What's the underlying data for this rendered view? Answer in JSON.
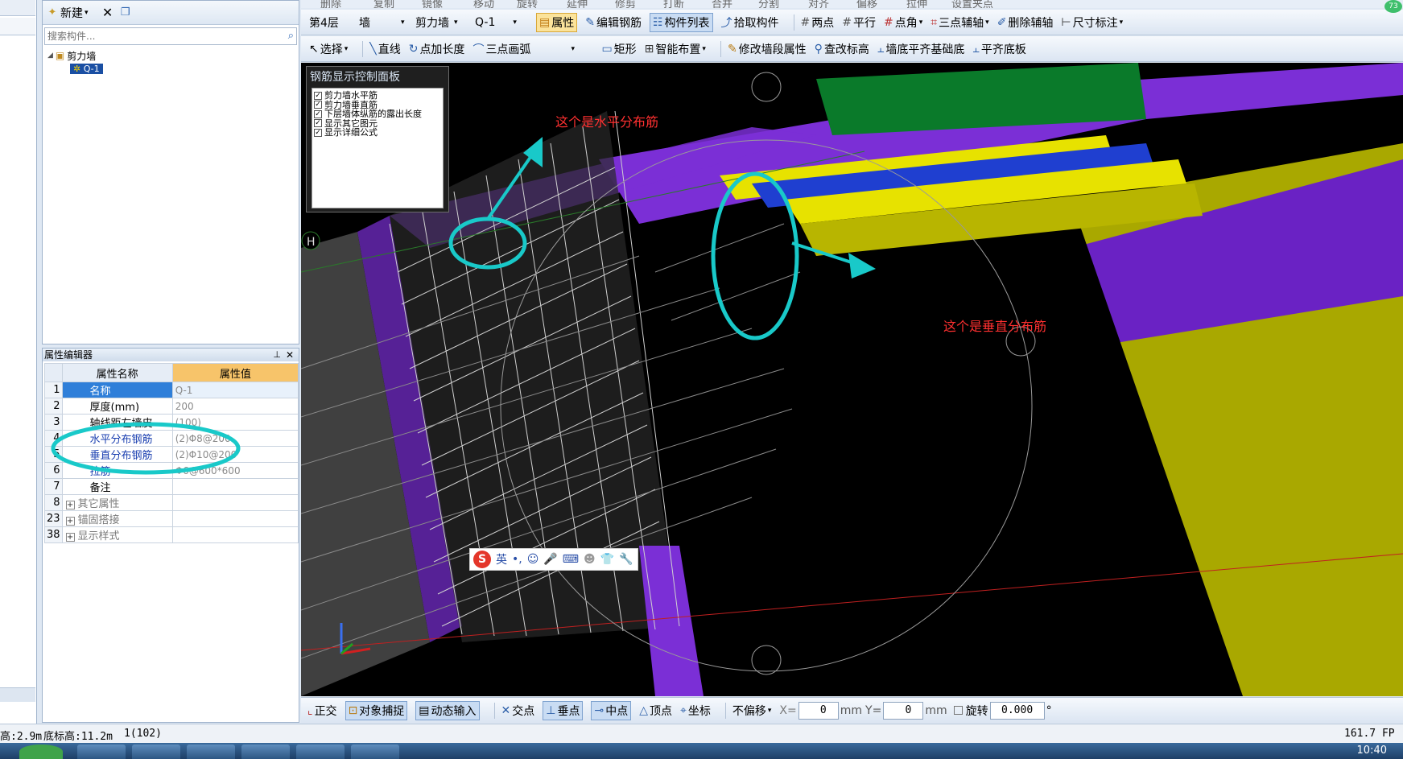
{
  "component_panel": {
    "new_label": "新建",
    "search_placeholder": "搜索构件...",
    "tree": {
      "root": "剪力墙",
      "child": "Q-1"
    }
  },
  "property_editor": {
    "title": "属性编辑器",
    "header_name": "属性名称",
    "header_value": "属性值",
    "rows": [
      {
        "num": "1",
        "name": "名称",
        "value": "Q-1"
      },
      {
        "num": "2",
        "name": "厚度(mm)",
        "value": "200"
      },
      {
        "num": "3",
        "name": "轴线距左墙皮",
        "value": "(100)"
      },
      {
        "num": "4",
        "name": "水平分布钢筋",
        "value": "(2)Φ8@200"
      },
      {
        "num": "5",
        "name": "垂直分布钢筋",
        "value": "(2)Φ10@200"
      },
      {
        "num": "6",
        "name": "拉筋",
        "value": "Φ6@600*600"
      },
      {
        "num": "7",
        "name": "备注",
        "value": ""
      },
      {
        "num": "8",
        "name": "其它属性",
        "value": ""
      },
      {
        "num": "23",
        "name": "锚固搭接",
        "value": ""
      },
      {
        "num": "38",
        "name": "显示样式",
        "value": ""
      }
    ]
  },
  "toolbar_top": [
    "删除",
    "复制",
    "镜像",
    "移动",
    "旋转",
    "延伸",
    "修剪",
    "打断",
    "合并",
    "分割",
    "对齐",
    "偏移",
    "拉伸",
    "设置夹点"
  ],
  "toolbar_1": {
    "floor": "第4层",
    "category": "墙",
    "type": "剪力墙",
    "component": "Q-1",
    "property": "属性",
    "edit_rebar": "编辑钢筋",
    "component_list": "构件列表",
    "pick_component": "拾取构件",
    "two_points": "两点",
    "parallel": "平行",
    "point_angle": "点角",
    "three_point_axis": "三点辅轴",
    "delete_axis": "删除辅轴",
    "dimension": "尺寸标注"
  },
  "toolbar_2": {
    "select": "选择",
    "line": "直线",
    "point_length": "点加长度",
    "three_point_arc": "三点画弧",
    "rectangle": "矩形",
    "smart_layout": "智能布置",
    "modify_wall_segment": "修改墙段属性",
    "check_elevation": "查改标高",
    "wall_bottom_align_foundation": "墙底平齐基础底",
    "align_bottom": "平齐底板"
  },
  "rebar_panel": {
    "title": "钢筋显示控制面板",
    "options": [
      "剪力墙水平筋",
      "剪力墙垂直筋",
      "下层墙体纵筋的露出长度",
      "显示其它图元",
      "显示详细公式"
    ]
  },
  "annotations": {
    "horizontal": "这个是水平分布筋",
    "vertical": "这个是垂直分布筋"
  },
  "viewport": {
    "axis_marker": "H"
  },
  "ime": {
    "lang": "英",
    "logo": "S"
  },
  "snap_bar": {
    "ortho": "正交",
    "object_snap": "对象捕捉",
    "dynamic_input": "动态输入",
    "intersection": "交点",
    "perpendicular": "垂点",
    "midpoint": "中点",
    "vertex": "顶点",
    "coordinate": "坐标",
    "offset": "不偏移",
    "x_label": "X=",
    "x_value": "0",
    "mm1": "mm",
    "y_label": "Y=",
    "y_value": "0",
    "mm2": "mm",
    "rotate": "旋转",
    "rotate_value": "0.000",
    "degree": "°"
  },
  "status_bar": {
    "height": "高:2.9m",
    "bottom_elev": "底标高:11.2m",
    "count": "1(102)",
    "fps": "161.7 FP"
  },
  "clock": "10:40",
  "badge": "73",
  "colors": {
    "viewport_bg": "#000000",
    "purple": "#7b2fd6",
    "green": "#0a7a2a",
    "yellow": "#e7e200",
    "olive": "#a9a800",
    "annotation_red": "#ff3030",
    "highlight_cyan": "#19c9c9"
  }
}
